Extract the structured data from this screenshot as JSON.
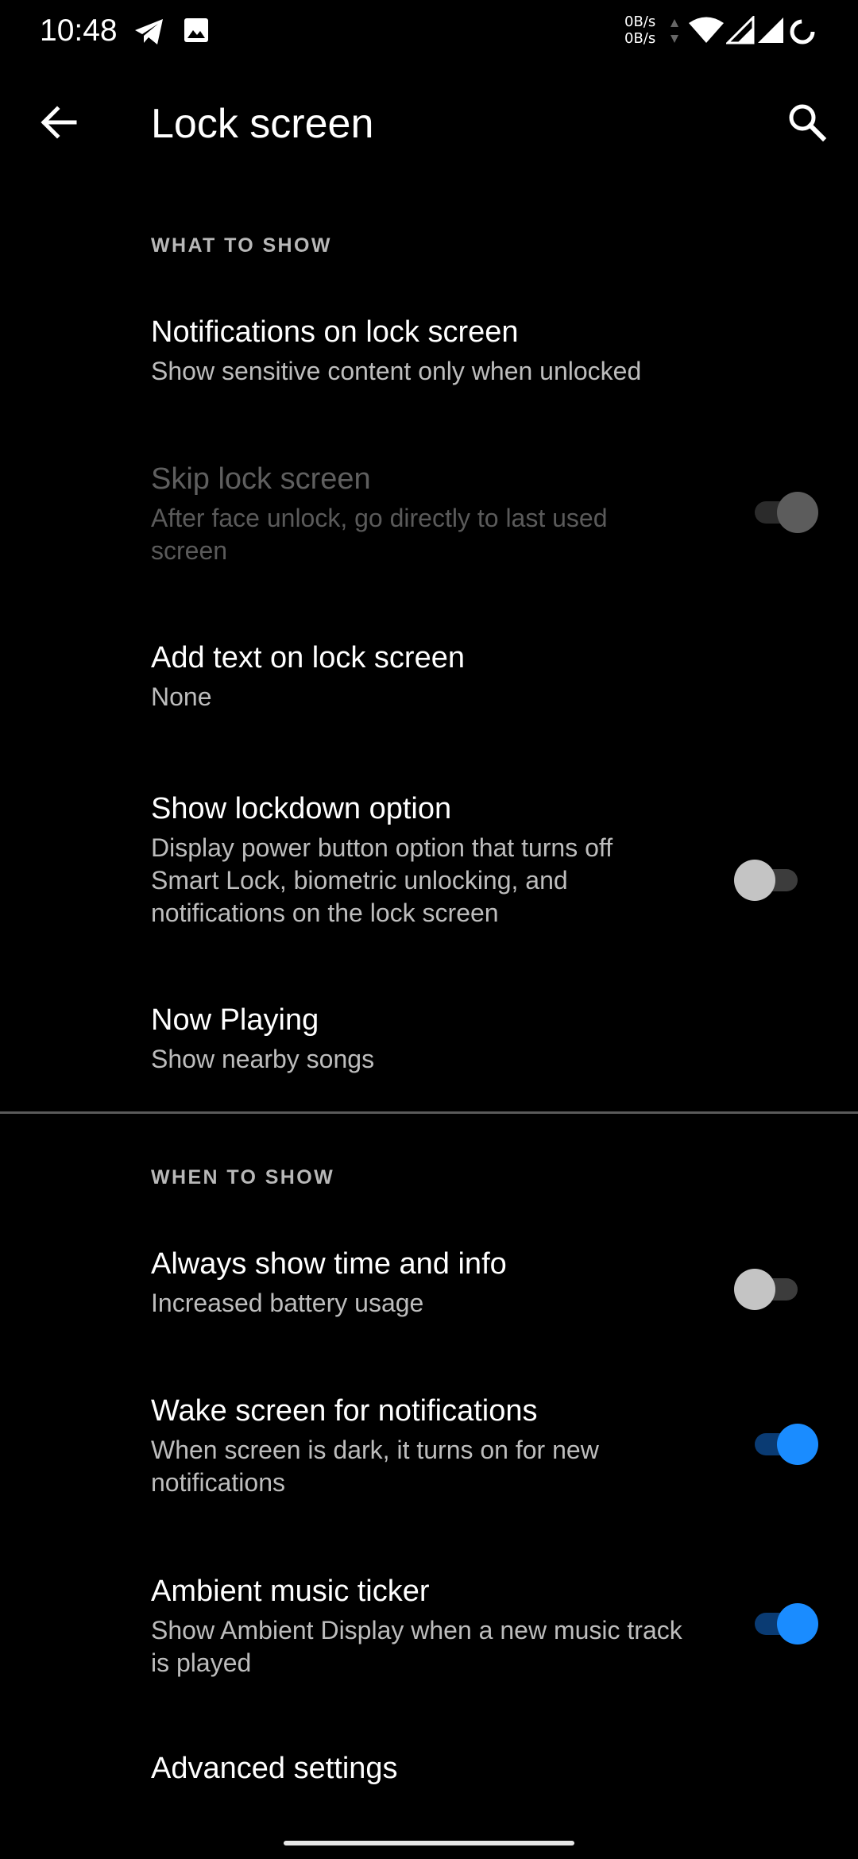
{
  "status_bar": {
    "time": "10:48",
    "net_up": "0B/s",
    "net_down": "0B/s",
    "icons": [
      "telegram-icon",
      "image-icon",
      "wifi-icon",
      "signal-icon",
      "signal-icon",
      "battery-saver-icon"
    ]
  },
  "app_bar": {
    "title": "Lock screen",
    "back_icon": "arrow-left-icon",
    "search_icon": "search-icon"
  },
  "sections": [
    {
      "header": "WHAT TO SHOW",
      "items": [
        {
          "title": "Notifications on lock screen",
          "summary": "Show sensitive content only when unlocked"
        },
        {
          "title": "Skip lock screen",
          "summary": "After face unlock, go directly to last used screen",
          "toggle": "on",
          "enabled": false
        },
        {
          "title": "Add text on lock screen",
          "summary": "None"
        },
        {
          "title": "Show lockdown option",
          "summary": "Display power button option that turns off Smart Lock, biometric unlocking, and notifications on the lock screen",
          "toggle": "off"
        },
        {
          "title": "Now Playing",
          "summary": "Show nearby songs"
        }
      ]
    },
    {
      "header": "WHEN TO SHOW",
      "items": [
        {
          "title": "Always show time and info",
          "summary": "Increased battery usage",
          "toggle": "off"
        },
        {
          "title": "Wake screen for notifications",
          "summary": "When screen is dark, it turns on for new notifications",
          "toggle": "on"
        },
        {
          "title": "Ambient music ticker",
          "summary": "Show Ambient Display when a new music track is played",
          "toggle": "on"
        },
        {
          "title": "Advanced settings"
        }
      ]
    }
  ],
  "colors": {
    "background": "#000000",
    "accent": "#1a8cff",
    "summary_text": "#bdbdbd",
    "disabled_text": "#5f5f5f"
  }
}
